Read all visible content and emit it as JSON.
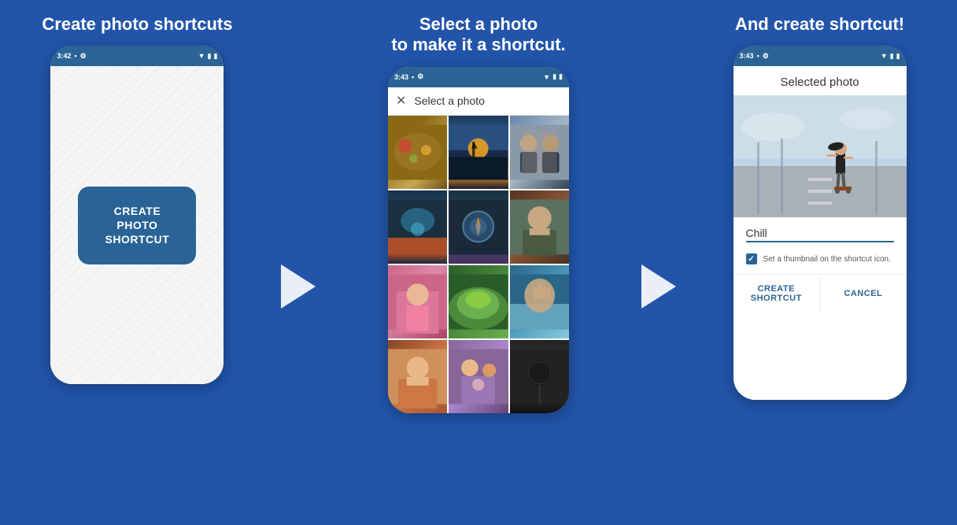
{
  "sections": [
    {
      "id": "section1",
      "title": "Create photo shortcuts",
      "phone": {
        "status_time": "3:42",
        "body_type": "stripes",
        "button_label": "CREATE PHOTO\nSHORTCUT"
      }
    },
    {
      "id": "section2",
      "title": "Select a photo\nto make it a shortcut.",
      "phone": {
        "status_time": "3:43",
        "header_title": "Select a photo",
        "body_type": "grid",
        "photo_count": 12
      }
    },
    {
      "id": "section3",
      "title": "And create shortcut!",
      "phone": {
        "status_time": "3:43",
        "body_type": "detail",
        "selected_photo_label": "Selected photo",
        "input_value": "Chill",
        "thumbnail_option_text": "Set a thumbnail on the shortcut icon.",
        "buttons": {
          "create": "CREATE\nSHORTCUT",
          "cancel": "CANCEL"
        }
      }
    }
  ]
}
